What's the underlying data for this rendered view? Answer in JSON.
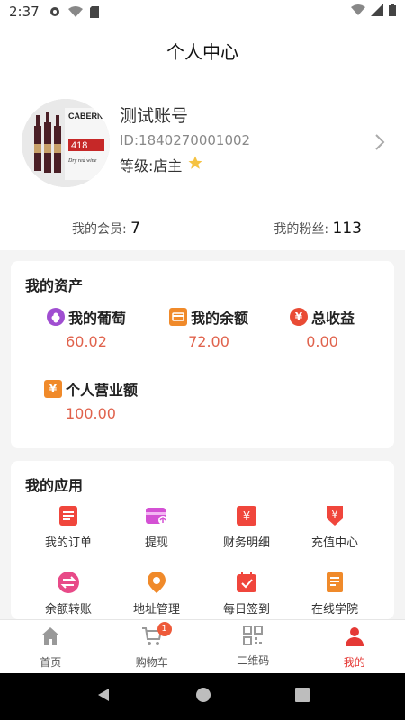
{
  "status_bar": {
    "time": "2:37"
  },
  "header": {
    "title": "个人中心"
  },
  "profile": {
    "name": "测试账号",
    "id_text": "ID:1840270001002",
    "level_text": "等级:店主",
    "avatar_text": {
      "brand": "CABERNET",
      "price": "418",
      "sub": "Dry red wine"
    },
    "members_label": "我的会员:",
    "members_count": "7",
    "fans_label": "我的粉丝:",
    "fans_count": "113"
  },
  "assets": {
    "title": "我的资产",
    "items": [
      {
        "label": "我的葡萄",
        "value": "60.02",
        "icon": "grape-icon"
      },
      {
        "label": "我的余额",
        "value": "72.00",
        "icon": "wallet-icon"
      },
      {
        "label": "总收益",
        "value": "0.00",
        "icon": "yuan-coin-icon"
      },
      {
        "label": "个人营业额",
        "value": "100.00",
        "icon": "yuan-tag-icon"
      }
    ]
  },
  "apps": {
    "title": "我的应用",
    "items": [
      {
        "label": "我的订单",
        "icon": "order-icon"
      },
      {
        "label": "提现",
        "icon": "withdraw-icon"
      },
      {
        "label": "财务明细",
        "icon": "finance-icon"
      },
      {
        "label": "充值中心",
        "icon": "recharge-icon"
      },
      {
        "label": "余额转账",
        "icon": "transfer-icon"
      },
      {
        "label": "地址管理",
        "icon": "location-icon"
      },
      {
        "label": "每日签到",
        "icon": "checkin-icon"
      },
      {
        "label": "在线学院",
        "icon": "book-icon"
      }
    ]
  },
  "tabbar": {
    "items": [
      {
        "label": "首页",
        "icon": "home-icon"
      },
      {
        "label": "购物车",
        "icon": "cart-icon",
        "badge": "1"
      },
      {
        "label": "二维码",
        "icon": "qrcode-icon"
      },
      {
        "label": "我的",
        "icon": "person-icon",
        "active": true
      }
    ]
  },
  "colors": {
    "accent": "#e53935",
    "value": "#e0624c",
    "badge": "#ee5a3a"
  }
}
